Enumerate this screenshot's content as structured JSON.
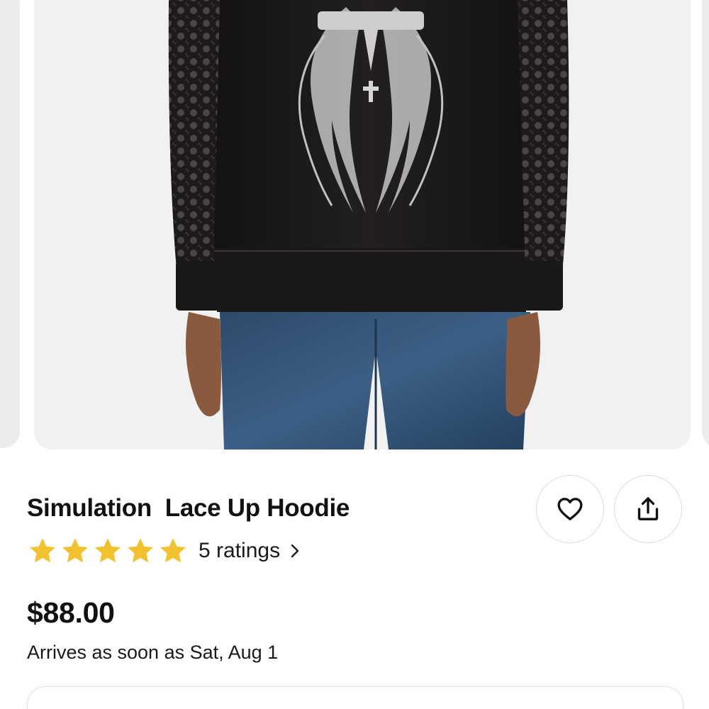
{
  "product": {
    "title": "Simulation  Lace Up Hoodie",
    "rating": {
      "stars": 5,
      "max_stars": 5,
      "label": "5 ratings",
      "star_color": "#f2c12e"
    },
    "price": "$88.00",
    "delivery": "Arrives as soon as Sat, Aug 1"
  },
  "carousel": {
    "image": "product-photo-back-view-black-lace-hoodie-wing-print"
  },
  "actions": {
    "favorite_icon": "heart-icon",
    "share_icon": "share-icon"
  }
}
